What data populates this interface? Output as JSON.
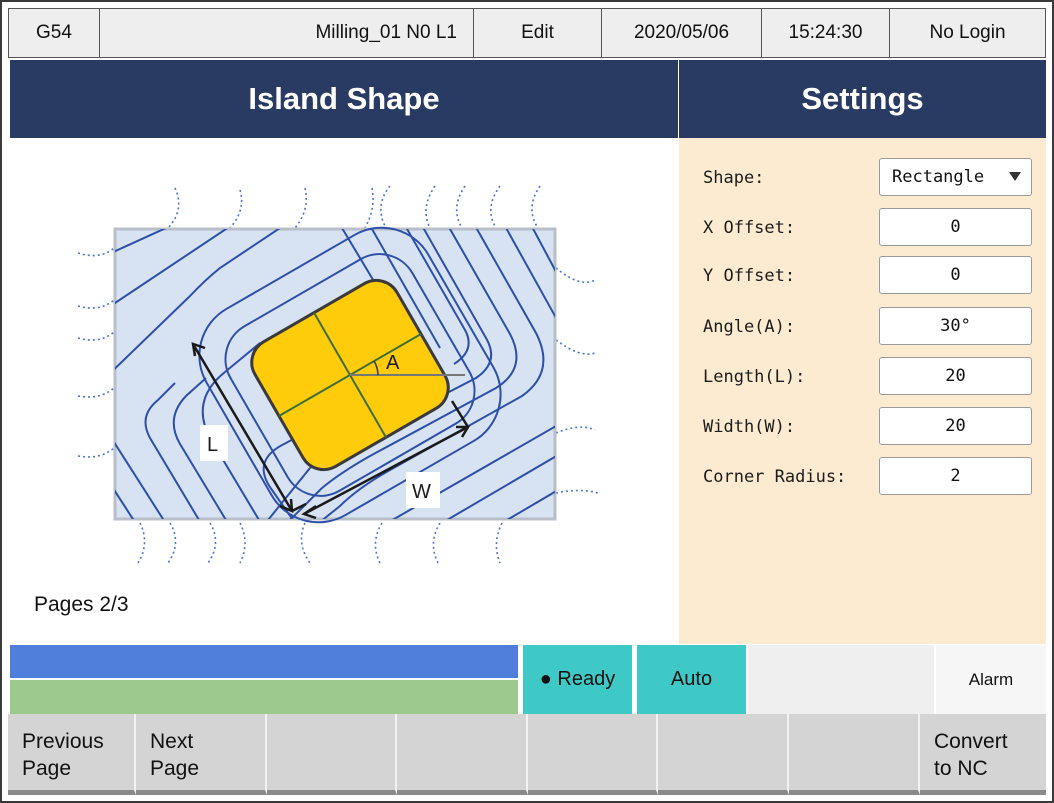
{
  "topbar": {
    "coord_system": "G54",
    "program": "Milling_01 N0 L1",
    "mode": "Edit",
    "date": "2020/05/06",
    "time": "15:24:30",
    "login": "No Login"
  },
  "headers": {
    "left": "Island Shape",
    "right": "Settings"
  },
  "diagram": {
    "label_angle": "A",
    "label_length": "L",
    "label_width": "W",
    "island_color": "#fecc0a",
    "stock_color": "#d7e2f3",
    "toolpath_color": "#2d4fa7"
  },
  "pages_label": "Pages 2/3",
  "settings": [
    {
      "label": "Shape:",
      "value": "Rectangle",
      "type": "select"
    },
    {
      "label": "X Offset:",
      "value": "0",
      "type": "input"
    },
    {
      "label": "Y Offset:",
      "value": "0",
      "type": "input"
    },
    {
      "label": "Angle(A):",
      "value": "30°",
      "type": "input"
    },
    {
      "label": "Length(L):",
      "value": "20",
      "type": "input"
    },
    {
      "label": "Width(W):",
      "value": "20",
      "type": "input"
    },
    {
      "label": "Corner Radius:",
      "value": "2",
      "type": "input"
    }
  ],
  "status": {
    "ready": "● Ready",
    "auto": "Auto",
    "alarm": "Alarm"
  },
  "softkeys": [
    "Previous\nPage",
    "Next\nPage",
    "",
    "",
    "",
    "",
    "",
    "Convert\nto NC"
  ]
}
